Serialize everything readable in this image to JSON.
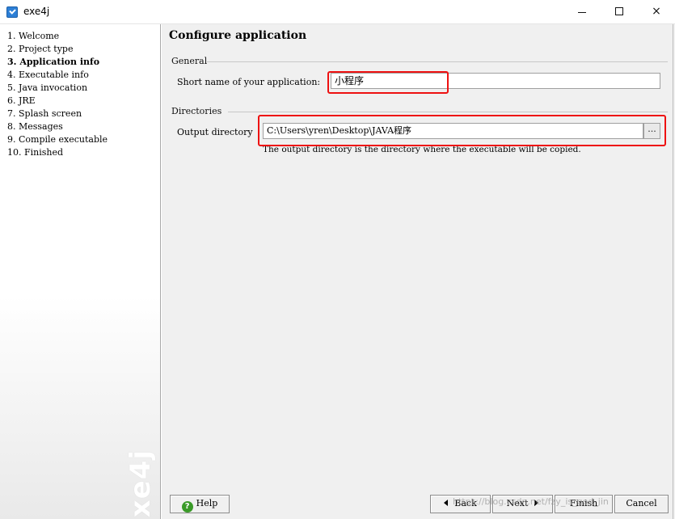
{
  "window": {
    "title": "exe4j",
    "icon": "exe4j-app-icon",
    "controls": {
      "minimize": "minimize-icon",
      "maximize": "maximize-icon",
      "close": "×"
    }
  },
  "sidebar": {
    "steps": [
      {
        "label": "1. Welcome",
        "active": false
      },
      {
        "label": "2. Project type",
        "active": false
      },
      {
        "label": "3. Application info",
        "active": true
      },
      {
        "label": "4. Executable info",
        "active": false
      },
      {
        "label": "5. Java invocation",
        "active": false
      },
      {
        "label": "6. JRE",
        "active": false
      },
      {
        "label": "7. Splash screen",
        "active": false
      },
      {
        "label": "8. Messages",
        "active": false
      },
      {
        "label": "9. Compile executable",
        "active": false
      },
      {
        "label": "10. Finished",
        "active": false
      }
    ],
    "watermark": "exe4j"
  },
  "main": {
    "title": "Configure application",
    "general": {
      "group_label": "General",
      "short_name_label": "Short name of your application:",
      "short_name_value": "小程序"
    },
    "directories": {
      "group_label": "Directories",
      "output_label": "Output directory",
      "output_value": "C:\\Users\\yren\\Desktop\\JAVA程序",
      "browse_label": "...",
      "hint": "The output directory is the directory where the executable will be copied."
    }
  },
  "buttons": {
    "help": "Help",
    "back": "Back",
    "next": "Next",
    "finish": "Finish",
    "cancel": "Cancel"
  },
  "overlay": {
    "watermark_text": "https://blog.csdn.net/fzy_is_god_jin",
    "highlight_color": "#ee1111"
  }
}
